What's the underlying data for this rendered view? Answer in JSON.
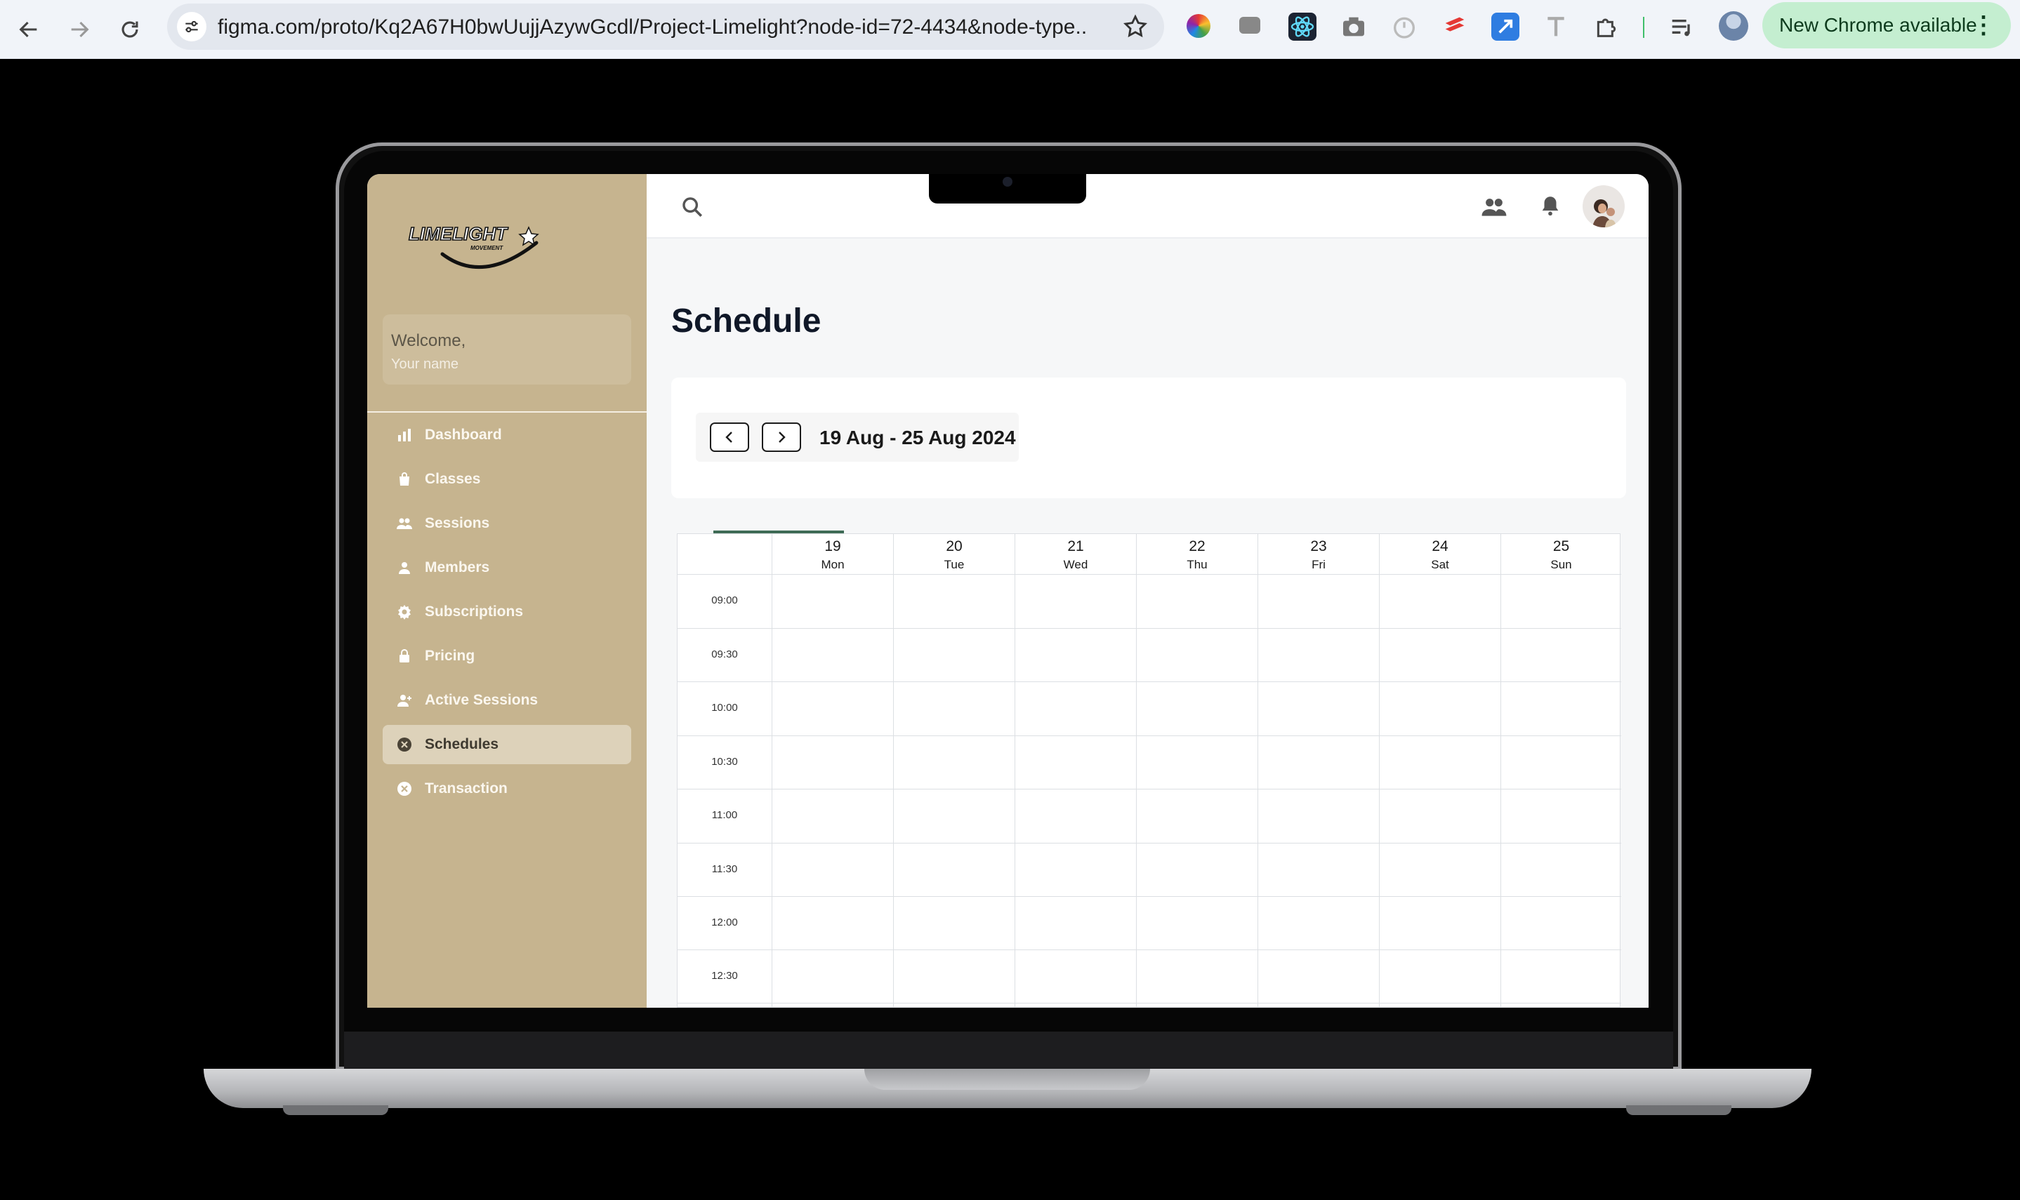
{
  "browser": {
    "url": "figma.com/proto/Kq2A67H0bwUujjAzywGcdl/Project-Limelight?node-id=72-4434&node-type...",
    "update_label": "New Chrome available"
  },
  "app": {
    "logo_text": "LIMELIGHT",
    "logo_sub": "MOVEMENT",
    "welcome_title": "Welcome,",
    "welcome_name": "Your name",
    "nav": [
      {
        "label": "Dashboard",
        "icon": "bar-chart-icon"
      },
      {
        "label": "Classes",
        "icon": "bag-icon"
      },
      {
        "label": "Sessions",
        "icon": "group-icon"
      },
      {
        "label": "Members",
        "icon": "person-icon"
      },
      {
        "label": "Subscriptions",
        "icon": "gear-icon"
      },
      {
        "label": "Pricing",
        "icon": "lock-icon"
      },
      {
        "label": "Active Sessions",
        "icon": "person-add-icon"
      },
      {
        "label": "Schedules",
        "icon": "x-circle-icon",
        "active": true
      },
      {
        "label": "Transaction",
        "icon": "x-circle-icon"
      }
    ],
    "page_title": "Schedule",
    "week_range": "19 Aug - 25 Aug 2024",
    "days": [
      {
        "num": "19",
        "name": "Mon"
      },
      {
        "num": "20",
        "name": "Tue"
      },
      {
        "num": "21",
        "name": "Wed"
      },
      {
        "num": "22",
        "name": "Thu"
      },
      {
        "num": "23",
        "name": "Fri"
      },
      {
        "num": "24",
        "name": "Sat"
      },
      {
        "num": "25",
        "name": "Sun"
      }
    ],
    "times": [
      "09:00",
      "09:30",
      "10:00",
      "10:30",
      "11:00",
      "11:30",
      "12:00",
      "12:30"
    ],
    "colors": {
      "sidebar": "#c6b48f",
      "accent": "#3e6b55",
      "update_button": "#c4eed0"
    }
  }
}
